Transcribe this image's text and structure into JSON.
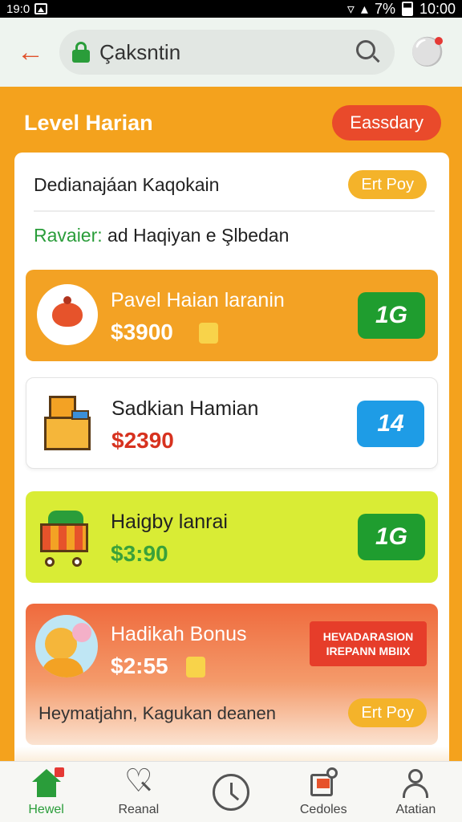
{
  "status_bar": {
    "time_left": "19:0",
    "battery_percent": "7%",
    "clock": "10:00"
  },
  "search": {
    "value": "Çaksntin"
  },
  "header": {
    "title": "Level Harian",
    "pill_label": "Eassdary"
  },
  "card_top": {
    "title": "Dedianajáan Kaqokain",
    "pill": "Ert Poy",
    "subtitle_accent": "Ravaier:",
    "subtitle_rest": " ad Haqiyan e Şlbedan"
  },
  "items": [
    {
      "name": "Pavel Haian laranin",
      "price": "$3900",
      "badge": "1G"
    },
    {
      "name": "Sadkian Hamian",
      "price": "$2390",
      "badge": "14"
    },
    {
      "name": "Haigby lanrai",
      "price": "$3:90",
      "badge": "1G"
    }
  ],
  "bonus": {
    "name": "Hadikah Bonus",
    "price": "$2:55",
    "label_line1": "HEVADARASION",
    "label_line2": "IREPANN MBIIX",
    "footer": "Heymatjahn, Kagukan deanen",
    "pill": "Ert Poy"
  },
  "nav": [
    {
      "label": "Hewel",
      "icon": "home-icon"
    },
    {
      "label": "Reanal",
      "icon": "heart-search-icon"
    },
    {
      "label": "",
      "icon": "clock-icon"
    },
    {
      "label": "Cedoles",
      "icon": "tag-icon"
    },
    {
      "label": "Atatian",
      "icon": "person-icon"
    }
  ],
  "colors": {
    "orange": "#f4a21d",
    "green": "#1f9d2f",
    "blue": "#1e9ce6",
    "red": "#e94a2b",
    "lime": "#d9ec35"
  }
}
